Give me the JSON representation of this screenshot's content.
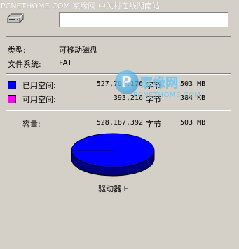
{
  "watermark_text": "PCNETHOME.COM 家缘网 中关村在线湖南站",
  "drive": {
    "icon": "drive-icon",
    "name_value": ""
  },
  "type": {
    "label": "类型:",
    "value": "可移动磁盘"
  },
  "filesystem": {
    "label": "文件系统:",
    "value": "FAT"
  },
  "used": {
    "label": "已用空间:",
    "bytes": "527,794,176",
    "unit": "字节",
    "size": "503 MB",
    "color": "#0000ff"
  },
  "free": {
    "label": "可用空间:",
    "bytes": "393,216",
    "unit": "字节",
    "size": "384 KB",
    "color": "#ff00ff"
  },
  "capacity": {
    "label": "容量:",
    "bytes": "528,187,392",
    "unit": "字节",
    "size": "503 MB"
  },
  "drive_label": "驱动器 F",
  "logo": {
    "mark": "P",
    "cn": "家缘网",
    "en": "PCNETHOME.COM"
  },
  "pie": {
    "used_bytes": 527794176,
    "free_bytes": 393216,
    "used_color": "#0000ff",
    "free_color": "#ff00ff"
  }
}
